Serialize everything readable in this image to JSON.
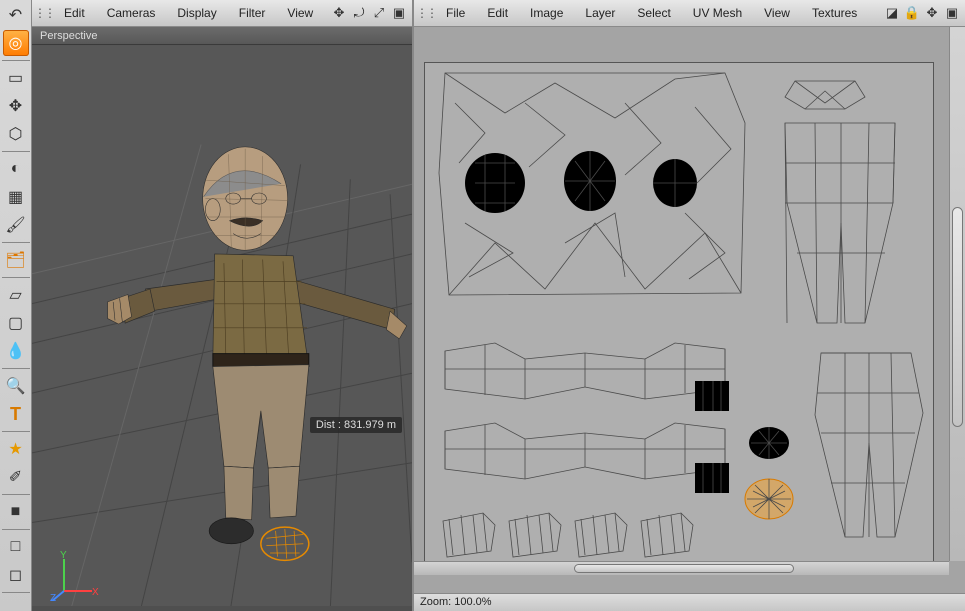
{
  "menusLeft": {
    "items": [
      "Edit",
      "Cameras",
      "Display",
      "Filter",
      "View"
    ],
    "rightIcons": [
      "move-icon",
      "rotate-icon",
      "scale-icon",
      "frame-icon"
    ]
  },
  "menusRight": {
    "items": [
      "File",
      "Edit",
      "Image",
      "Layer",
      "Select",
      "UV Mesh",
      "View",
      "Textures"
    ],
    "rightIcons": [
      "histogram-icon",
      "lock-icon",
      "move-icon",
      "maximize-icon"
    ]
  },
  "leftPalette": {
    "tools": [
      {
        "name": "undo-icon",
        "glyph": "↶"
      },
      {
        "name": "live-select-icon",
        "glyph": "◎",
        "active": true
      },
      {
        "name": "rect-select-icon",
        "glyph": "▭"
      },
      {
        "name": "move-tool-icon",
        "glyph": "✥"
      },
      {
        "name": "magnet-icon",
        "glyph": "⬡"
      },
      {
        "name": "lasso-icon",
        "glyph": "◐"
      },
      {
        "name": "checker-icon",
        "glyph": "▦"
      },
      {
        "name": "brush-icon",
        "glyph": "🖌"
      },
      {
        "name": "hierarchy-icon",
        "glyph": "🗂"
      },
      {
        "name": "eraser-icon",
        "glyph": "▱"
      },
      {
        "name": "frame-icon",
        "glyph": "▢"
      },
      {
        "name": "drop-icon",
        "glyph": "💧"
      },
      {
        "name": "zoom-icon",
        "glyph": "🔍"
      },
      {
        "name": "text-tool-icon",
        "glyph": "T"
      },
      {
        "name": "star-tool-icon",
        "glyph": "★"
      },
      {
        "name": "eyedropper-icon",
        "glyph": "✐"
      },
      {
        "name": "swatch-fg-icon",
        "glyph": "■"
      },
      {
        "name": "swatch-bg-icon",
        "glyph": "□"
      },
      {
        "name": "channel-icon",
        "glyph": "◻"
      }
    ]
  },
  "viewport": {
    "label": "Perspective",
    "distance_label": "Dist : 831.979 m",
    "axes": {
      "x": "X",
      "y": "Y",
      "z": "Z"
    }
  },
  "uvPanel": {
    "zoom_label": "Zoom:",
    "zoom_value": "100.0%"
  }
}
